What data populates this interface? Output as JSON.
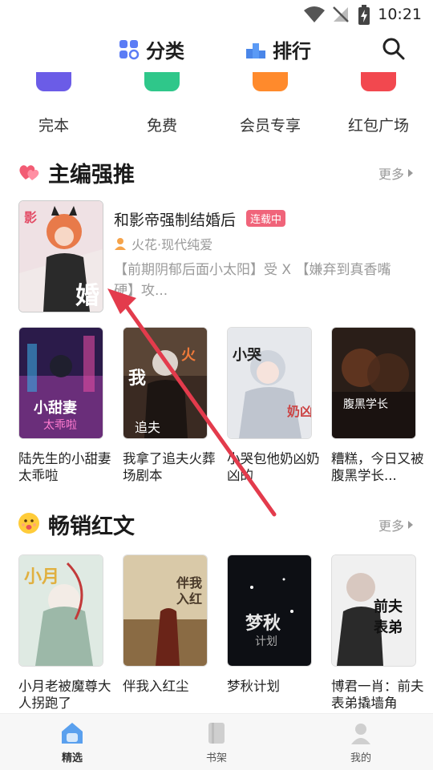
{
  "status_bar": {
    "time": "10:21"
  },
  "header": {
    "category_label": "分类",
    "ranking_label": "排行"
  },
  "quick_links": [
    {
      "label": "完本",
      "color": "#6b5ce7"
    },
    {
      "label": "免费",
      "color": "#2fc78a"
    },
    {
      "label": "会员专享",
      "color": "#ff8a2c"
    },
    {
      "label": "红包广场",
      "color": "#f2484f"
    }
  ],
  "section_editor": {
    "title": "主编强推",
    "more_label": "更多",
    "featured": {
      "title": "和影帝强制结婚后",
      "badge": "连载中",
      "author": "火花·现代纯爱",
      "desc": "【前期阴郁后面小太阳】受 X 【嫌弃到真香嘴硬】攻..."
    },
    "books": [
      {
        "title": "陆先生的小甜妻太乖啦"
      },
      {
        "title": "我拿了追夫火葬场剧本"
      },
      {
        "title": "小哭包他奶凶奶凶的"
      },
      {
        "title": "糟糕，今日又被腹黑学长..."
      }
    ]
  },
  "section_bestseller": {
    "title": "畅销红文",
    "more_label": "更多",
    "books": [
      {
        "title": "小月老被魔尊大人拐跑了"
      },
      {
        "title": "伴我入红尘"
      },
      {
        "title": "梦秋计划"
      },
      {
        "title": "博君一肖：前夫表弟撬墙角"
      }
    ]
  },
  "bottom_nav": [
    {
      "label": "精选",
      "active": true
    },
    {
      "label": "书架",
      "active": false
    },
    {
      "label": "我的",
      "active": false
    }
  ],
  "colors": {
    "accent": "#e33b4c",
    "badge": "#f0647a",
    "nav_active": "#4a90e2"
  }
}
